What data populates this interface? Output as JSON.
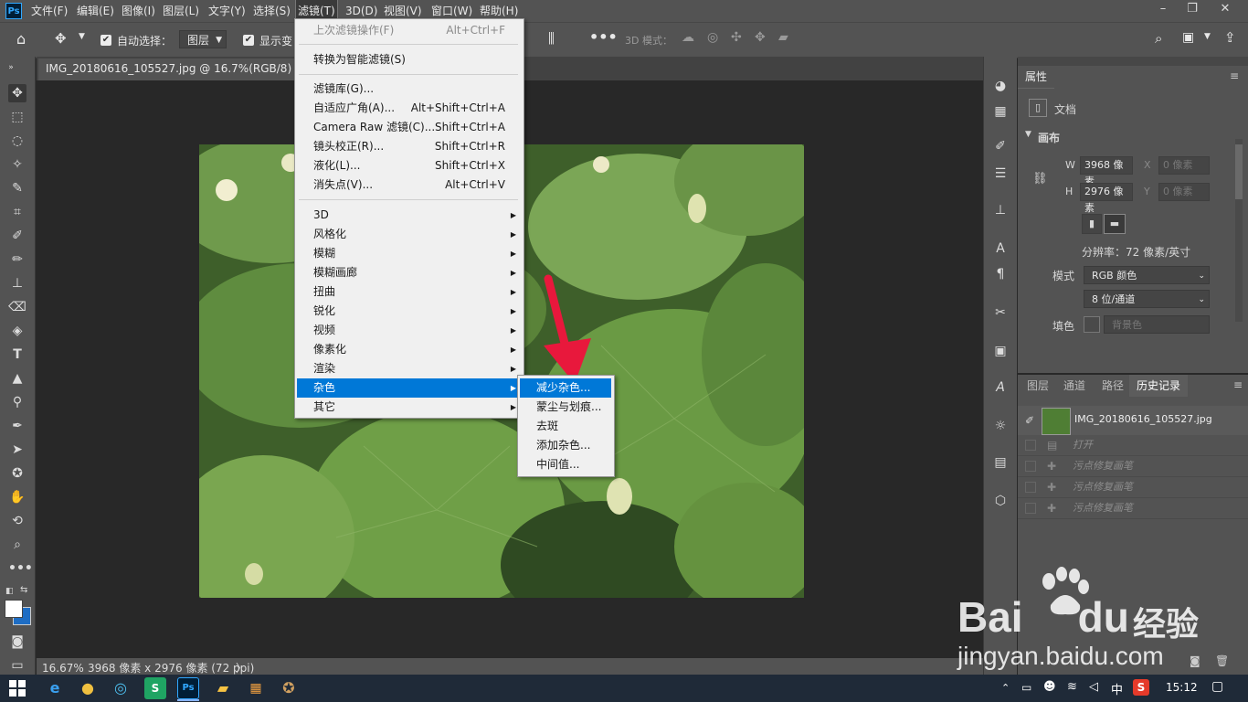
{
  "app": {
    "logo": "Ps"
  },
  "menubar": {
    "items": [
      "文件(F)",
      "编辑(E)",
      "图像(I)",
      "图层(L)",
      "文字(Y)",
      "选择(S)",
      "滤镜(T)",
      "3D(D)",
      "视图(V)",
      "窗口(W)",
      "帮助(H)"
    ],
    "active": "滤镜(T)",
    "window_controls": [
      "–",
      "❐",
      "✕"
    ]
  },
  "options_bar": {
    "auto_select_label": "自动选择：",
    "auto_select_checked": true,
    "layer_select_value": "图层",
    "show_transform_label": "显示变",
    "mode_3d_label": "3D 模式："
  },
  "document": {
    "tab_title": "IMG_20180616_105527.jpg @ 16.7%(RGB/8) *",
    "close_glyph": "×"
  },
  "status_bar": {
    "zoom": "16.67%",
    "info": "3968 像素 x 2976 像素 (72 ppi)",
    "arrow": "〉"
  },
  "filter_menu": {
    "items": [
      {
        "label": "上次滤镜操作(F)",
        "shortcut": "Alt+Ctrl+F",
        "disabled": true
      },
      {
        "label": "转换为智能滤镜(S)",
        "shortcut": ""
      },
      {
        "label": "滤镜库(G)...",
        "shortcut": ""
      },
      {
        "label": "自适应广角(A)...",
        "shortcut": "Alt+Shift+Ctrl+A"
      },
      {
        "label": "Camera Raw 滤镜(C)...",
        "shortcut": "Shift+Ctrl+A"
      },
      {
        "label": "镜头校正(R)...",
        "shortcut": "Shift+Ctrl+R"
      },
      {
        "label": "液化(L)...",
        "shortcut": "Shift+Ctrl+X"
      },
      {
        "label": "消失点(V)...",
        "shortcut": "Alt+Ctrl+V"
      },
      {
        "label": "3D",
        "submenu": true
      },
      {
        "label": "风格化",
        "submenu": true
      },
      {
        "label": "模糊",
        "submenu": true
      },
      {
        "label": "模糊画廊",
        "submenu": true
      },
      {
        "label": "扭曲",
        "submenu": true
      },
      {
        "label": "锐化",
        "submenu": true
      },
      {
        "label": "视频",
        "submenu": true
      },
      {
        "label": "像素化",
        "submenu": true
      },
      {
        "label": "渲染",
        "submenu": true
      },
      {
        "label": "杂色",
        "submenu": true,
        "highlighted": true
      },
      {
        "label": "其它",
        "submenu": true
      }
    ]
  },
  "noise_submenu": {
    "items": [
      "减少杂色...",
      "蒙尘与划痕...",
      "去斑",
      "添加杂色...",
      "中间值..."
    ],
    "highlighted": "减少杂色..."
  },
  "properties_panel": {
    "tab": "属性",
    "doc_label": "文档",
    "canvas_section": "画布",
    "w_label": "W",
    "w_value": "3968 像素",
    "h_label": "H",
    "h_value": "2976 像素",
    "x_label": "X",
    "x_placeholder": "0 像素",
    "y_label": "Y",
    "y_placeholder": "0 像素",
    "resolution": "分辨率：72 像素/英寸",
    "mode_label": "模式",
    "mode_value": "RGB 颜色",
    "depth_value": "8 位/通道",
    "fill_label": "填色",
    "fill_value": "背景色"
  },
  "history_panel": {
    "tabs": [
      "图层",
      "通道",
      "路径",
      "历史记录"
    ],
    "active_tab": "历史记录",
    "snapshot": "IMG_20180616_105527.jpg",
    "steps": [
      "打开",
      "污点修复画笔",
      "污点修复画笔",
      "污点修复画笔"
    ]
  },
  "taskbar": {
    "ime": "中",
    "time": "15:12"
  },
  "watermark": {
    "brand": "Bai",
    "brand2": "du",
    "cn": "经验",
    "url": "jingyan.baidu.com"
  },
  "colors": {
    "menu_highlight": "#0078d7",
    "arrow_red": "#e8183c",
    "panel_bg": "#535353",
    "canvas_bg": "#282828"
  }
}
